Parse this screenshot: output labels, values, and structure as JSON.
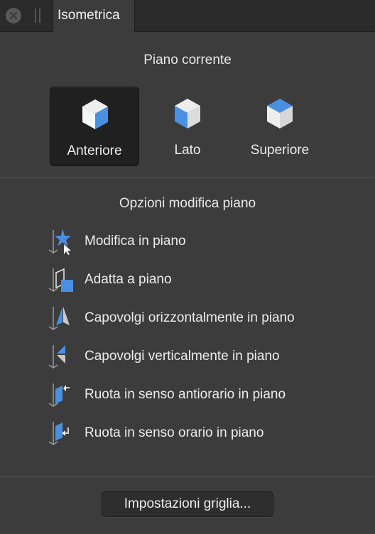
{
  "window": {
    "tab_title": "Isometrica"
  },
  "current_plane": {
    "heading": "Piano corrente",
    "buttons": [
      {
        "label": "Anteriore",
        "active": true
      },
      {
        "label": "Lato",
        "active": false
      },
      {
        "label": "Superiore",
        "active": false
      }
    ]
  },
  "plane_edit_options": {
    "heading": "Opzioni modifica piano",
    "items": [
      {
        "label": "Modifica in piano",
        "icon": "edit-in-plane-icon"
      },
      {
        "label": "Adatta a piano",
        "icon": "fit-to-plane-icon"
      },
      {
        "label": "Capovolgi orizzontalmente in piano",
        "icon": "flip-horizontal-icon"
      },
      {
        "label": "Capovolgi verticalmente in piano",
        "icon": "flip-vertical-icon"
      },
      {
        "label": "Ruota in senso antiorario in piano",
        "icon": "rotate-counterclockwise-icon"
      },
      {
        "label": "Ruota in senso orario in piano",
        "icon": "rotate-clockwise-icon"
      }
    ]
  },
  "footer": {
    "grid_settings_label": "Impostazioni griglia..."
  },
  "colors": {
    "accent": "#4a90e2",
    "panel_bg": "#3c3c3c",
    "tabbar_bg": "#2a2a2a",
    "text": "#ececec"
  }
}
